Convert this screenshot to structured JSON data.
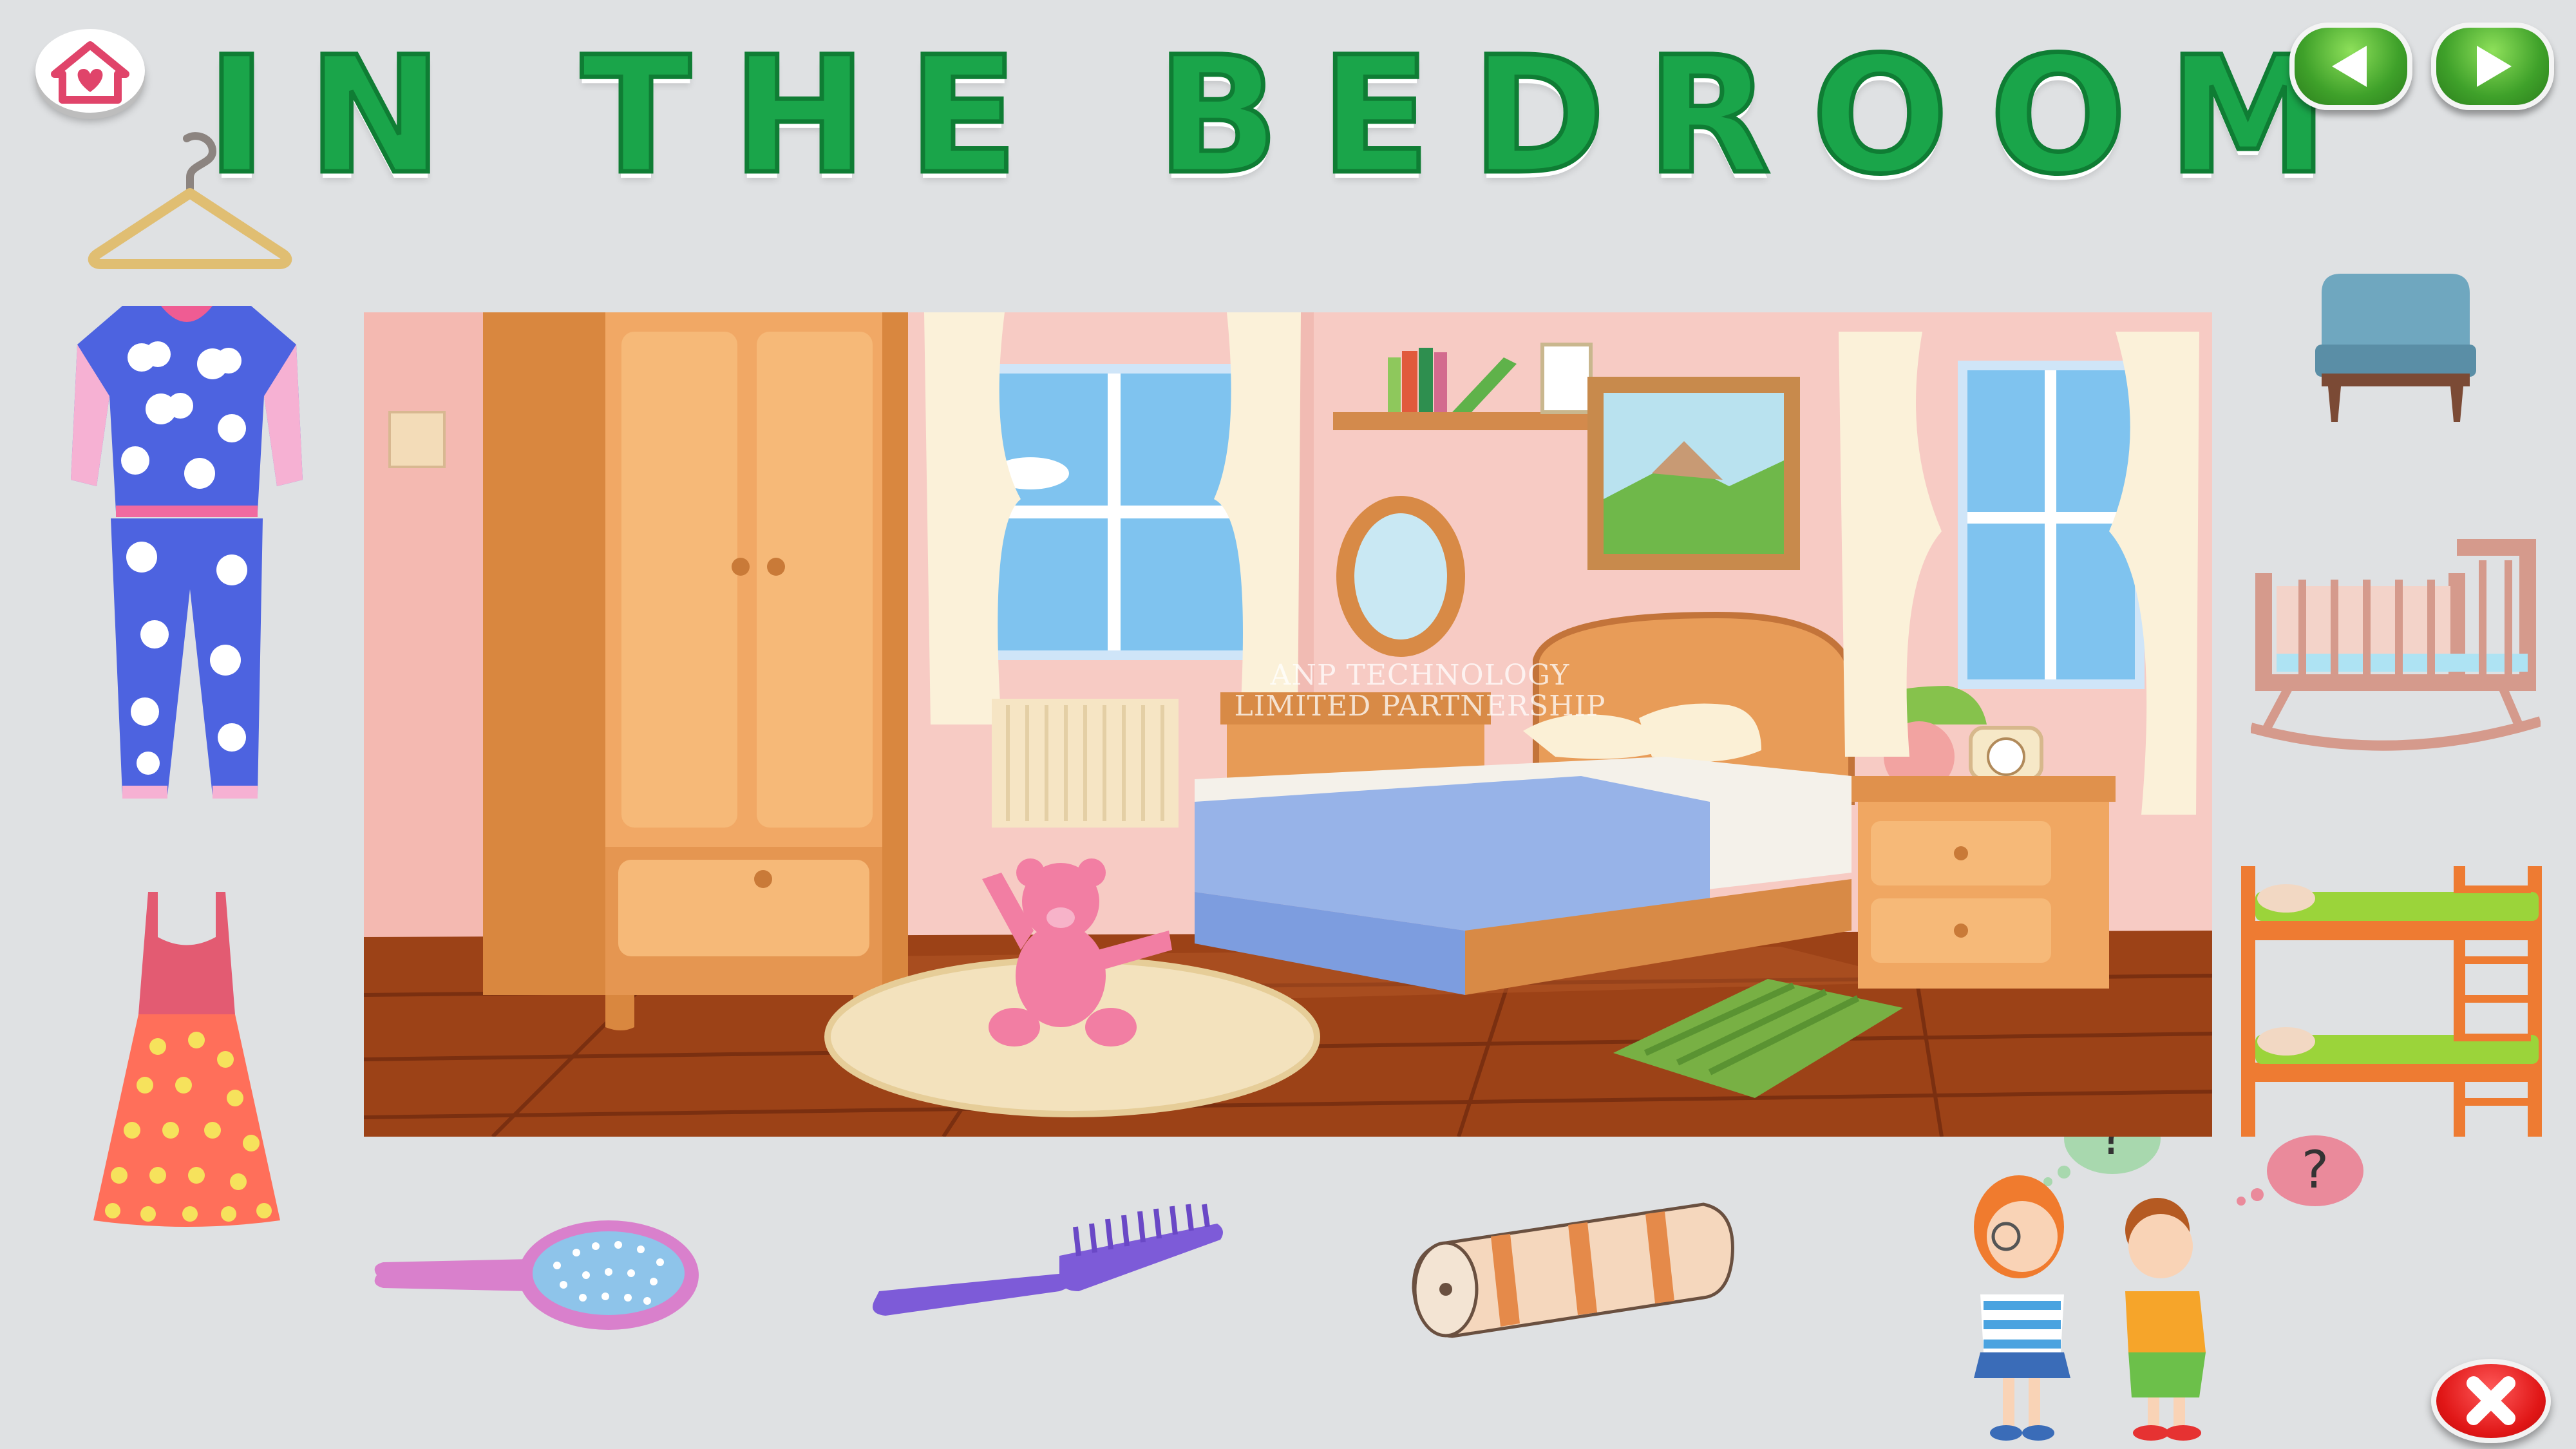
{
  "title": "IN THE BEDROOM",
  "scene": {
    "watermark_line1": "ANP TECHNOLOGY",
    "watermark_line2": "LIMITED PARTNERSHIP"
  },
  "bubbles": {
    "girl": "?",
    "boy": "?"
  },
  "icons": {
    "home": "home-heart-icon",
    "prev": "arrow-left-icon",
    "next": "arrow-right-icon",
    "close": "close-x-icon"
  },
  "colors": {
    "background": "#dfe1e3",
    "title": "#1aa54a",
    "nav_button": "#3fa12a",
    "close_button": "#e01616",
    "home_icon": "#e0446a"
  }
}
